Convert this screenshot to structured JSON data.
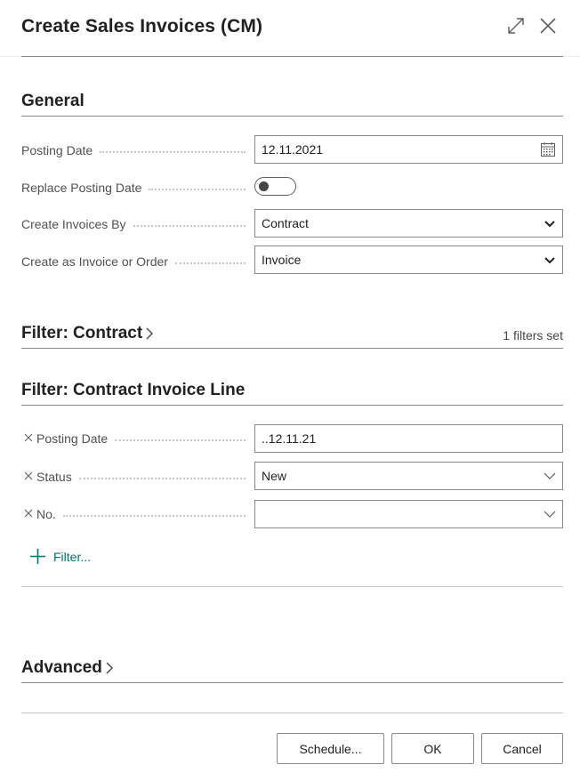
{
  "dialog": {
    "title": "Create Sales Invoices (CM)",
    "expand_icon": "expand-icon",
    "close_icon": "close-icon"
  },
  "general": {
    "title": "General",
    "posting_date": {
      "label": "Posting Date",
      "value": "12.11.2021",
      "icon": "calendar-icon"
    },
    "replace_posting_date": {
      "label": "Replace Posting Date",
      "value": false
    },
    "create_invoices_by": {
      "label": "Create Invoices By",
      "value": "Contract"
    },
    "create_as": {
      "label": "Create as Invoice or Order",
      "value": "Invoice"
    }
  },
  "filter_contract": {
    "title": "Filter: Contract",
    "status": "1 filters set"
  },
  "filter_contract_invoice_line": {
    "title": "Filter: Contract Invoice Line",
    "fields": [
      {
        "label": "Posting Date",
        "value": "..12.11.21"
      },
      {
        "label": "Status",
        "value": "New"
      },
      {
        "label": "No.",
        "value": ""
      }
    ],
    "add_filter_label": "Filter..."
  },
  "advanced": {
    "title": "Advanced"
  },
  "buttons": {
    "schedule": "Schedule...",
    "ok": "OK",
    "cancel": "Cancel"
  },
  "colors": {
    "accent": "#00756d",
    "border": "#8a8886",
    "text": "#212121"
  }
}
